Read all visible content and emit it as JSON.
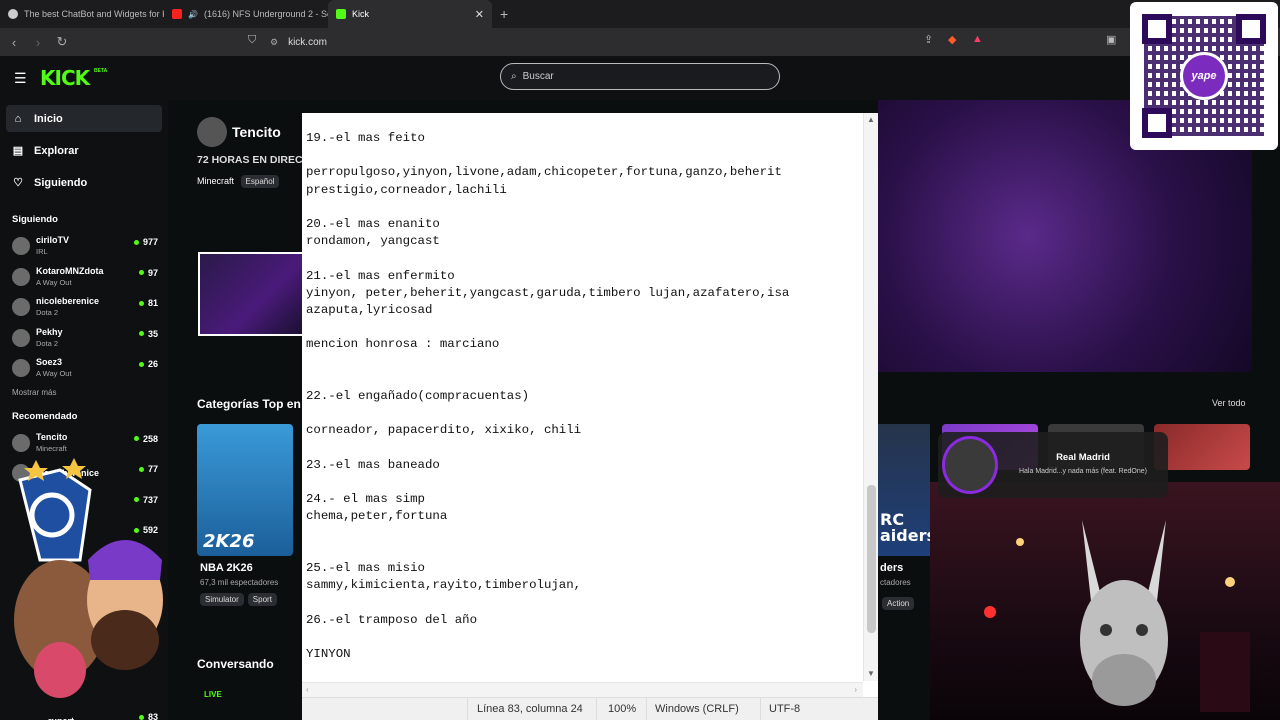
{
  "browser": {
    "tabs": [
      {
        "title": "The best ChatBot and Widgets for Ki",
        "color": "#cccccc"
      },
      {
        "title": "(1616) NFS Underground 2 - Sou",
        "color": "#ff2020"
      },
      {
        "title": "Kick",
        "color": "#53fc18"
      }
    ],
    "url": "kick.com"
  },
  "kick": {
    "logo": "KICK",
    "beta": "BETA",
    "search_placeholder": "Buscar",
    "nav": [
      {
        "label": "Inicio",
        "icon": "home-icon"
      },
      {
        "label": "Explorar",
        "icon": "compass-icon"
      },
      {
        "label": "Siguiendo",
        "icon": "heart-icon"
      }
    ],
    "following_title": "Siguiendo",
    "following": [
      {
        "name": "ciriloTV",
        "game": "IRL",
        "viewers": "977"
      },
      {
        "name": "KotaroMNZdota",
        "game": "A Way Out",
        "viewers": "97"
      },
      {
        "name": "nicoleberenice",
        "game": "Dota 2",
        "viewers": "81"
      },
      {
        "name": "Pekhy",
        "game": "Dota 2",
        "viewers": "35"
      },
      {
        "name": "Soez3",
        "game": "A Way Out",
        "viewers": "26"
      }
    ],
    "show_more": "Mostrar más",
    "recommended_title": "Recomendado",
    "recommended": [
      {
        "name": "Tencito",
        "game": "Minecraft",
        "viewers": "258"
      },
      {
        "name": "nicoleberenice",
        "game": "",
        "viewers": "77"
      },
      {
        "name": "",
        "game": "",
        "viewers": "737"
      },
      {
        "name": "",
        "game": "",
        "viewers": "592"
      }
    ],
    "rec_last": {
      "name": "rupert",
      "viewers": "83"
    },
    "streamer": {
      "name": "Tencito",
      "title": "72 HORAS EN DIREC",
      "category": "Minecraft",
      "tag": "Español"
    },
    "top_categories_title": "Categorías Top en",
    "see_all": "Ver todo",
    "card": {
      "name": "NBA 2K26",
      "viewers": "67,3 mil espectadores",
      "tags": [
        "Simulator",
        "Sport"
      ],
      "art_label": "2K26"
    },
    "card_right": {
      "name": "ders",
      "viewers": "ctadores",
      "tag": "Action",
      "art_label": "RC\naiders"
    },
    "conversando": "Conversando",
    "live": "LIVE"
  },
  "spotify": {
    "song": "Real Madrid",
    "artist": "Hala Madrid...y nada más (feat. RedOne)"
  },
  "qr": {
    "label": "yape"
  },
  "notepad": {
    "lines": [
      "19.-el mas feito",
      "",
      "perropulgoso,yinyon,livone,adam,chicopeter,fortuna,ganzo,beherit",
      "prestigio,corneador,lachili",
      "",
      "20.-el mas enanito",
      "rondamon, yangcast",
      "",
      "21.-el mas enfermito",
      "yinyon, peter,beherit,yangcast,garuda,timbero lujan,azafatero,isa",
      "azaputa,lyricosad",
      "",
      "mencion honrosa : marciano",
      "",
      "",
      "22.-el engañado(compracuentas)",
      "",
      "corneador, papacerdito, xixiko, chili",
      "",
      "23.-el mas baneado",
      "",
      "24.- el mas simp",
      "chema,peter,fortuna",
      "",
      "",
      "25.-el mas misio",
      "sammy,kimicienta,rayito,timberolujan,",
      "",
      "26.-el tramposo del año",
      "",
      "YINYON"
    ],
    "status": {
      "position": "Línea 83, columna 24",
      "zoom": "100%",
      "line_ending": "Windows (CRLF)",
      "encoding": "UTF-8"
    }
  }
}
